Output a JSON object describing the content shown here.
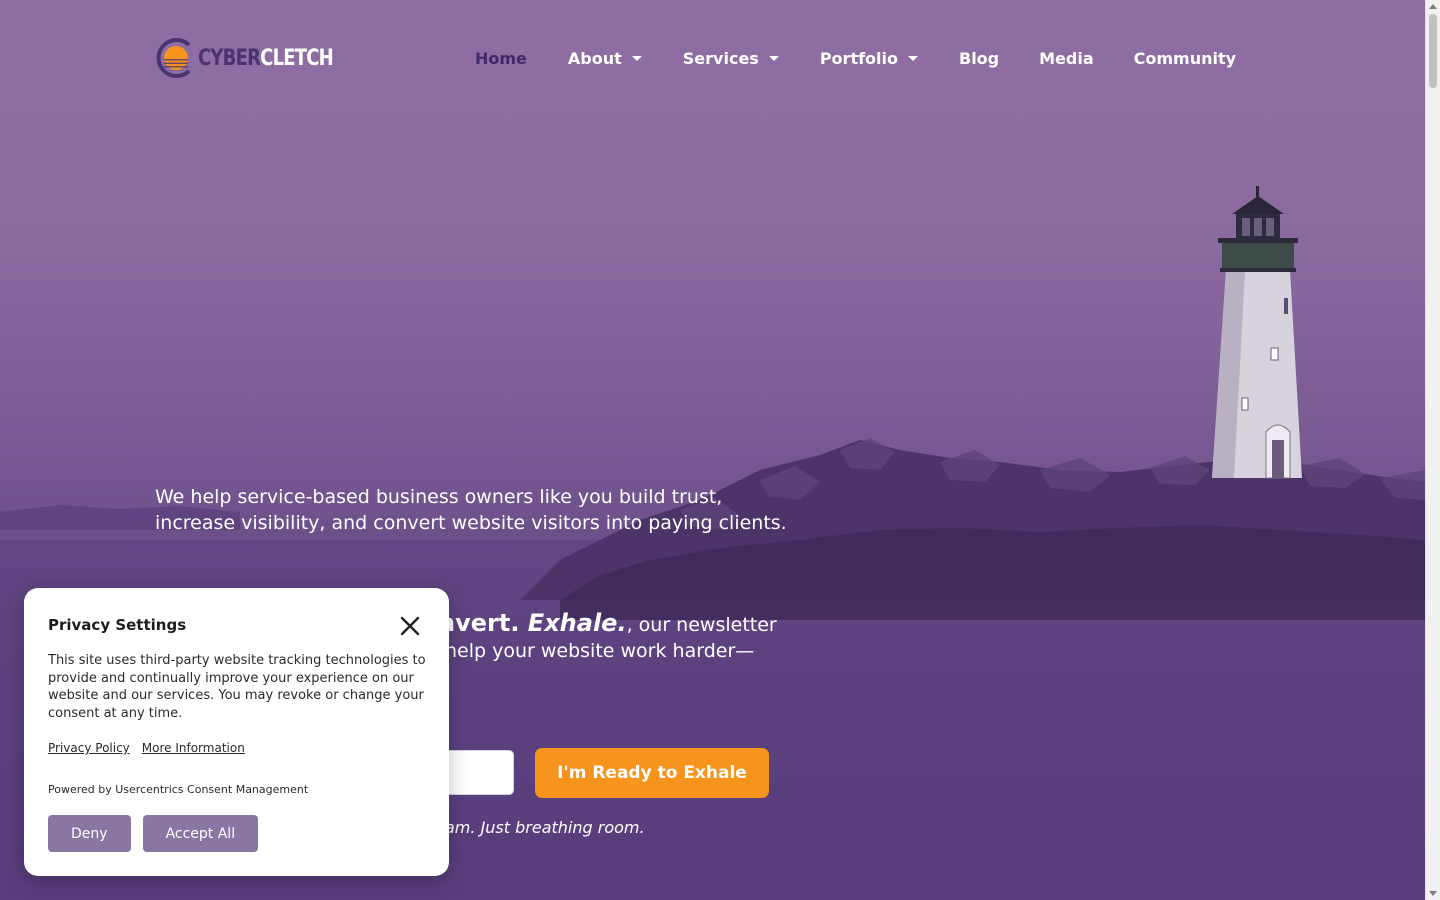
{
  "colors": {
    "accent_orange": "#f7941d",
    "nav_active": "#3e2a66",
    "consent_button": "#8a76a3",
    "logo_dark": "#4a3470"
  },
  "logo": {
    "part1": "CYBER",
    "part2": "CLETCH",
    "icon": "sunset-circle-logo"
  },
  "nav": {
    "items": [
      {
        "label": "Home",
        "active": true,
        "dropdown": false
      },
      {
        "label": "About",
        "active": false,
        "dropdown": true
      },
      {
        "label": "Services",
        "active": false,
        "dropdown": true
      },
      {
        "label": "Portfolio",
        "active": false,
        "dropdown": true
      },
      {
        "label": "Blog",
        "active": false,
        "dropdown": false
      },
      {
        "label": "Media",
        "active": false,
        "dropdown": false
      },
      {
        "label": "Community",
        "active": false,
        "dropdown": false
      }
    ]
  },
  "hero": {
    "subheadline": "We help service-based business owners like you build trust, increase visibility, and convert website visitors into paying clients.",
    "newsletter_suffix": ", our newsletter",
    "newsletter_line2": "help your website work harder—",
    "newsletter_brand_fragment": "nvert.",
    "newsletter_brand_italic": "Exhale.",
    "email_placeholder": "",
    "cta_label": "I'm Ready to Exhale",
    "note": "am. Just breathing room."
  },
  "consent": {
    "title": "Privacy Settings",
    "body": "This site uses third-party website tracking technologies to provide and continually improve your experience on our website and our services. You may revoke or change your consent at any time.",
    "privacy_policy": "Privacy Policy",
    "more_info": "More Information",
    "powered_by": "Powered by Usercentrics Consent Management",
    "deny": "Deny",
    "accept_all": "Accept All"
  }
}
